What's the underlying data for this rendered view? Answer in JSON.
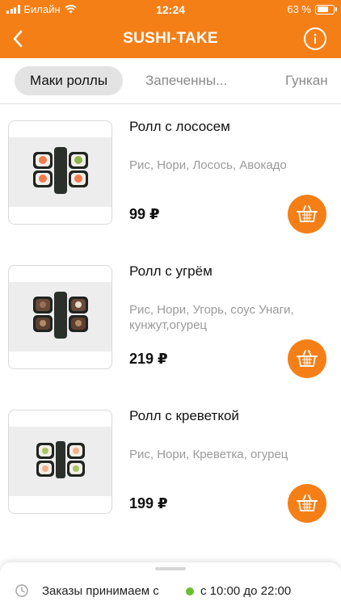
{
  "status_bar": {
    "carrier": "Билайн",
    "time": "12:24",
    "battery_percent": "63 %",
    "battery_level": 0.63
  },
  "header": {
    "title": "SUSHI-TAKE",
    "back_icon": "chevron-left-icon",
    "info_icon": "info-icon",
    "accent_color": "#f57f17"
  },
  "tabs": [
    {
      "label": "Маки роллы",
      "active": true
    },
    {
      "label": "Запеченны...",
      "active": false
    },
    {
      "label": "Гункан",
      "active": false
    }
  ],
  "products": [
    {
      "name": "Ролл с лососем",
      "description": "Рис, Нори, Лосось, Авокадо",
      "price": "99 ₽"
    },
    {
      "name": "Ролл с угрём",
      "description": "Рис, Нори, Угорь, соус Унаги, кунжут,огурец",
      "price": "219 ₽"
    },
    {
      "name": "Ролл с креветкой",
      "description": "Рис, Нори, Креветка, огурец",
      "price": "199 ₽"
    }
  ],
  "cart_icon": "basket-icon",
  "footer": {
    "label": "Заказы принимаем с",
    "hours": "с 10:00 до 22:00",
    "status_color": "#6abf2e"
  }
}
